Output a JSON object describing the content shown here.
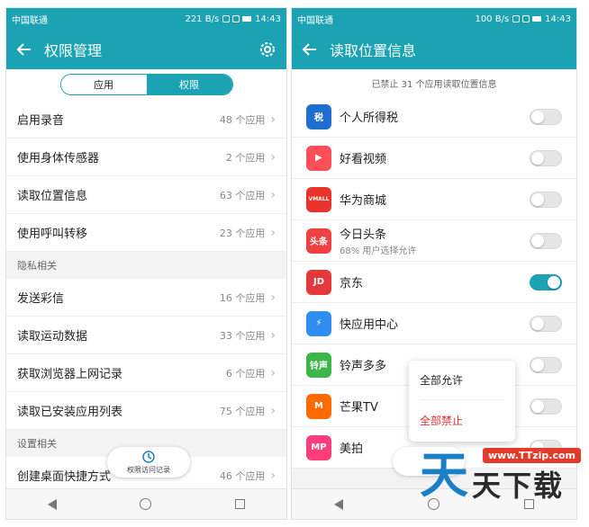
{
  "colors": {
    "accent": "#1ba3b3",
    "danger": "#e0332c"
  },
  "left": {
    "status": {
      "carrier": "中国联通",
      "speed": "221 B/s",
      "time": "14:43"
    },
    "title": "权限管理",
    "segments": {
      "app": "应用",
      "permission": "权限"
    },
    "rows_top": [
      {
        "label": "启用录音",
        "count": "48 个应用"
      },
      {
        "label": "使用身体传感器",
        "count": "2 个应用"
      },
      {
        "label": "读取位置信息",
        "count": "63 个应用"
      },
      {
        "label": "使用呼叫转移",
        "count": "23 个应用"
      }
    ],
    "section_privacy": "隐私相关",
    "rows_privacy": [
      {
        "label": "发送彩信",
        "count": "16 个应用"
      },
      {
        "label": "读取运动数据",
        "count": "33 个应用"
      },
      {
        "label": "获取浏览器上网记录",
        "count": "6 个应用"
      },
      {
        "label": "读取已安装应用列表",
        "count": "75 个应用"
      }
    ],
    "section_settings": "设置相关",
    "rows_settings": [
      {
        "label": "创建桌面快捷方式",
        "count": "46 个应用"
      }
    ],
    "float_button": "权限访问记录"
  },
  "right": {
    "status": {
      "carrier": "中国联通",
      "speed": "100 B/s",
      "time": "14:43"
    },
    "title": "读取位置信息",
    "summary": "已禁止 31 个应用读取位置信息",
    "apps": [
      {
        "name": "个人所得税",
        "sub": "",
        "on": false,
        "icon": "tax-app-icon",
        "color": "#1f6fd0",
        "glyph": "税"
      },
      {
        "name": "好看视频",
        "sub": "",
        "on": false,
        "icon": "haokan-app-icon",
        "color": "#ff4f5a",
        "glyph": "▶"
      },
      {
        "name": "华为商城",
        "sub": "",
        "on": false,
        "icon": "vmall-app-icon",
        "color": "#e8322a",
        "glyph": "VMALL"
      },
      {
        "name": "今日头条",
        "sub": "68% 用户选择允许",
        "on": false,
        "icon": "toutiao-app-icon",
        "color": "#f04142",
        "glyph": "头条"
      },
      {
        "name": "京东",
        "sub": "",
        "on": true,
        "icon": "jd-app-icon",
        "color": "#e4393c",
        "glyph": "JD"
      },
      {
        "name": "快应用中心",
        "sub": "",
        "on": false,
        "icon": "quickapp-app-icon",
        "color": "#2f8ef0",
        "glyph": "⚡"
      },
      {
        "name": "铃声多多",
        "sub": "",
        "on": false,
        "icon": "ringtone-app-icon",
        "color": "#3cb54a",
        "glyph": "铃声"
      },
      {
        "name": "芒果TV",
        "sub": "",
        "on": false,
        "icon": "mgtv-app-icon",
        "color": "#ff6a00",
        "glyph": "M"
      },
      {
        "name": "美拍",
        "sub": "",
        "on": false,
        "icon": "meipai-app-icon",
        "color": "#ff3d7a",
        "glyph": "MP"
      }
    ],
    "popup": {
      "allow_all": "全部允许",
      "deny_all": "全部禁止"
    }
  },
  "watermark": {
    "url": "www.TTzip.com",
    "big": "天",
    "text": "天下载"
  }
}
